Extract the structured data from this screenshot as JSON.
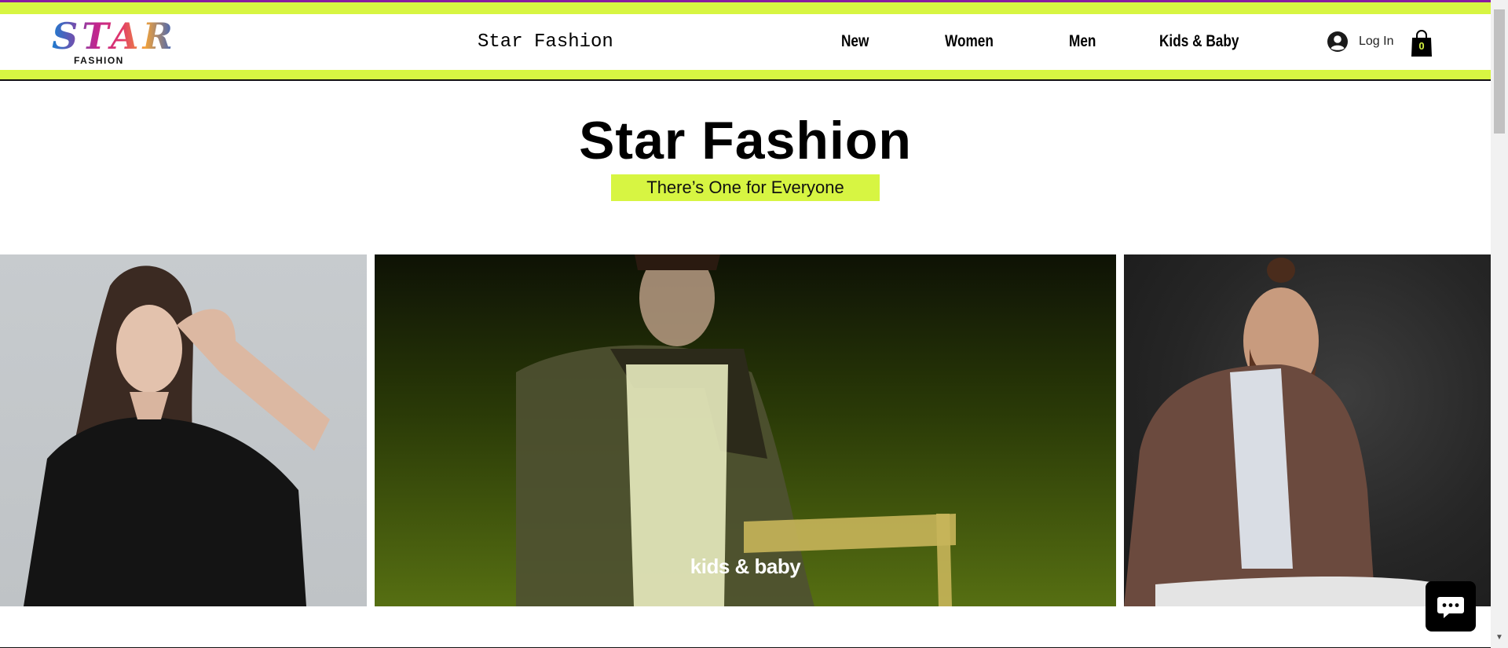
{
  "logo": {
    "text": "STAR",
    "subtext": "FASHION"
  },
  "header": {
    "site_title": "Star Fashion"
  },
  "nav": {
    "items": [
      {
        "label": "New"
      },
      {
        "label": "Women"
      },
      {
        "label": "Men"
      },
      {
        "label": "Kids & Baby"
      }
    ]
  },
  "account": {
    "login_label": "Log In",
    "avatar_icon": "user-avatar-icon"
  },
  "cart": {
    "count": "0",
    "icon": "shopping-bag-icon"
  },
  "hero": {
    "title": "Star Fashion",
    "tagline": "There’s One for Everyone"
  },
  "gallery": {
    "panels": [
      {
        "label": ""
      },
      {
        "label": "kids & baby"
      },
      {
        "label": ""
      }
    ]
  },
  "chat": {
    "icon": "chat-bubble-icon"
  },
  "colors": {
    "accent_lime": "#d7f542",
    "accent_purple": "#8a1aa0",
    "text": "#000000"
  }
}
